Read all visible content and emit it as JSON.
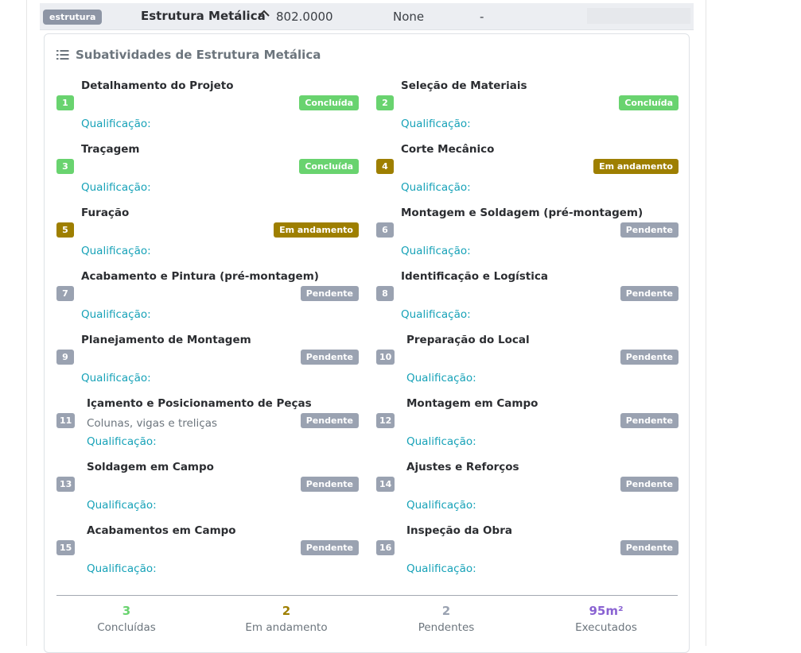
{
  "row": {
    "badge": "estrutura",
    "title": "Estrutura Metálica",
    "value": "802.0000",
    "none": "None",
    "dash": "-"
  },
  "card": {
    "title": "Subatividades de Estrutura Metálica",
    "qual_label": "Qualificação:"
  },
  "colors": {
    "done": "#69d36f",
    "in_progress": "#9e7f00",
    "pending": "#9aa2b1",
    "qualification": "#17a2b8",
    "executed": "#8a63d2"
  },
  "items": [
    {
      "num": "1",
      "name": "Detalhamento do Projeto",
      "subtitle": "",
      "status": "Concluída"
    },
    {
      "num": "2",
      "name": "Seleção de Materiais",
      "subtitle": "",
      "status": "Concluída"
    },
    {
      "num": "3",
      "name": "Traçagem",
      "subtitle": "",
      "status": "Concluída"
    },
    {
      "num": "4",
      "name": "Corte Mecânico",
      "subtitle": "",
      "status": "Em andamento"
    },
    {
      "num": "5",
      "name": "Furação",
      "subtitle": "",
      "status": "Em andamento"
    },
    {
      "num": "6",
      "name": "Montagem e Soldagem (pré-montagem)",
      "subtitle": "",
      "status": "Pendente"
    },
    {
      "num": "7",
      "name": "Acabamento e Pintura (pré-montagem)",
      "subtitle": "",
      "status": "Pendente"
    },
    {
      "num": "8",
      "name": "Identificação e Logística",
      "subtitle": "",
      "status": "Pendente"
    },
    {
      "num": "9",
      "name": "Planejamento de Montagem",
      "subtitle": "",
      "status": "Pendente"
    },
    {
      "num": "10",
      "name": "Preparação do Local",
      "subtitle": "",
      "status": "Pendente"
    },
    {
      "num": "11",
      "name": "Içamento e Posicionamento de Peças",
      "subtitle": "Colunas, vigas e treliças",
      "status": "Pendente"
    },
    {
      "num": "12",
      "name": "Montagem em Campo",
      "subtitle": "",
      "status": "Pendente"
    },
    {
      "num": "13",
      "name": "Soldagem em Campo",
      "subtitle": "",
      "status": "Pendente"
    },
    {
      "num": "14",
      "name": "Ajustes e Reforços",
      "subtitle": "",
      "status": "Pendente"
    },
    {
      "num": "15",
      "name": "Acabamentos em Campo",
      "subtitle": "",
      "status": "Pendente"
    },
    {
      "num": "16",
      "name": "Inspeção da Obra",
      "subtitle": "",
      "status": "Pendente"
    }
  ],
  "summary": [
    {
      "value": "3",
      "label": "Concluídas",
      "color": "#69d36f"
    },
    {
      "value": "2",
      "label": "Em andamento",
      "color": "#9e7f00"
    },
    {
      "value": "2",
      "label": "Pendentes",
      "color": "#9aa2b1"
    },
    {
      "value": "95m²",
      "label": "Executados",
      "color": "#8a63d2"
    }
  ]
}
